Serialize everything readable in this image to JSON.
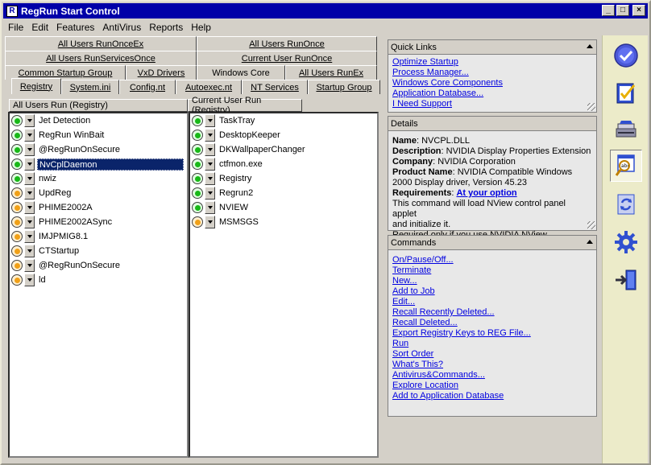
{
  "window": {
    "title": "RegRun Start Control",
    "app_icon": "R"
  },
  "menu": [
    "File",
    "Edit",
    "Features",
    "AntiVirus",
    "Reports",
    "Help"
  ],
  "tabs": {
    "row1": [
      "All Users RunOnceEx",
      "All Users RunOnce"
    ],
    "row2": [
      "All Users RunServicesOnce",
      "Current User RunOnce"
    ],
    "row3": [
      "Common Startup Group",
      "VxD Drivers",
      "Windows Core",
      "All Users RunEx"
    ],
    "row4": [
      "Registry",
      "System.ini",
      "Config.nt",
      "Autoexec.nt",
      "NT Services",
      "Startup Group"
    ]
  },
  "panes": {
    "left_header": "All Users Run (Registry)",
    "right_header": "Current User Run (Registry)"
  },
  "left_items": [
    {
      "label": "Jet Detection",
      "status": "green"
    },
    {
      "label": "RegRun WinBait",
      "status": "green"
    },
    {
      "label": "@RegRunOnSecure",
      "status": "green"
    },
    {
      "label": "NvCplDaemon",
      "status": "green",
      "selected": true
    },
    {
      "label": "nwiz",
      "status": "green"
    },
    {
      "label": "UpdReg",
      "status": "orange"
    },
    {
      "label": "PHIME2002A",
      "status": "orange"
    },
    {
      "label": "PHIME2002ASync",
      "status": "orange"
    },
    {
      "label": "IMJPMIG8.1",
      "status": "orange"
    },
    {
      "label": "CTStartup",
      "status": "orange"
    },
    {
      "label": "@RegRunOnSecure",
      "status": "orange"
    },
    {
      "label": "ld",
      "status": "orange"
    }
  ],
  "right_items": [
    {
      "label": "TaskTray",
      "status": "green"
    },
    {
      "label": "DesktopKeeper",
      "status": "green"
    },
    {
      "label": "DKWallpaperChanger",
      "status": "green"
    },
    {
      "label": "ctfmon.exe",
      "status": "green"
    },
    {
      "label": "Registry",
      "status": "green"
    },
    {
      "label": "Regrun2",
      "status": "green"
    },
    {
      "label": "NVIEW",
      "status": "green"
    },
    {
      "label": "MSMSGS",
      "status": "orange"
    }
  ],
  "quick_links": {
    "title": "Quick Links",
    "items": [
      "Optimize Startup",
      "Process Manager...",
      "Windows Core Components",
      "Application Database...",
      "I Need Support"
    ]
  },
  "details": {
    "title": "Details",
    "name_label": "Name",
    "name": "NVCPL.DLL",
    "description_label": "Description",
    "description": "NVIDIA Display Properties Extension",
    "company_label": "Company",
    "company": "NVIDIA Corporation",
    "product_label": "Product Name",
    "product_line1": "NVIDIA Compatible Windows",
    "product_line2": "2000 Display driver, Version 45.23",
    "requirements_label": "Requirements",
    "requirements": "At your option",
    "note_line1": "This command will load NView control panel applet",
    "note_line2": "and initialize it.",
    "note_line3": "Required only if you use NVIDIA NView."
  },
  "commands": {
    "title": "Commands",
    "items": [
      "On/Pause/Off...",
      "Terminate",
      "New...",
      "Add to Job",
      "Edit...",
      "Recall Recently Deleted...",
      "Recall  Deleted...",
      "Export Registry Keys to REG File...",
      "Run",
      "Sort Order",
      "What's This?",
      "Antivirus&Commands...",
      "Explore Location",
      "Add to Application Database"
    ]
  },
  "toolbar_icons": [
    "checkmark-circle-icon",
    "checklist-icon",
    "scanner-icon",
    "magnifier-document-icon",
    "refresh-icon",
    "gear-icon",
    "exit-door-icon"
  ],
  "colors": {
    "titlebar": "#0000a8",
    "selected": "#0a246a",
    "link": "#0000e0",
    "status_green": "#18b818",
    "status_orange": "#f0a018"
  }
}
